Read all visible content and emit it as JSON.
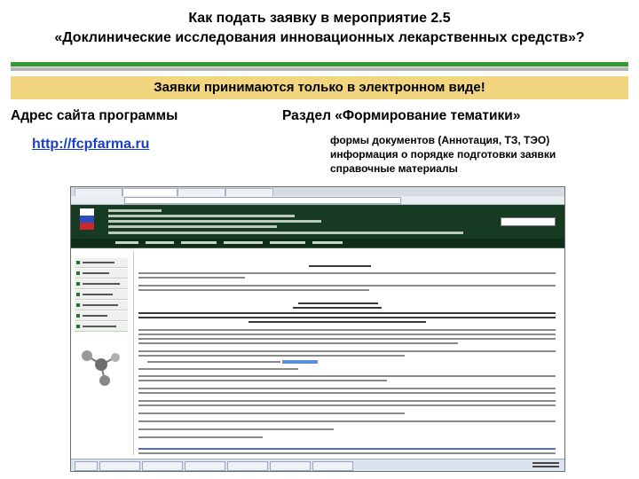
{
  "slide": {
    "title_line1": "Как подать заявку в мероприятие 2.5",
    "title_line2": "«Доклинические исследования инновационных лекарственных средств»?",
    "banner": "Заявки принимаются только в электронном виде!",
    "left_label": "Адрес сайта программы",
    "url": "http://fcpfarma.ru",
    "right_label": "Раздел «Формирование тематики»",
    "bullets": [
      "формы документов (Аннотация, ТЗ, ТЭО)",
      "информация о порядке подготовки заявки",
      "справочные материалы"
    ]
  },
  "colors": {
    "banner": "#f2d67f",
    "rule": "#339a33",
    "link": "#1a3fcc",
    "site_header": "#163a22"
  },
  "screenshot": {
    "description_icons": [
      "russian-flag-icon",
      "molecule-icon"
    ]
  }
}
